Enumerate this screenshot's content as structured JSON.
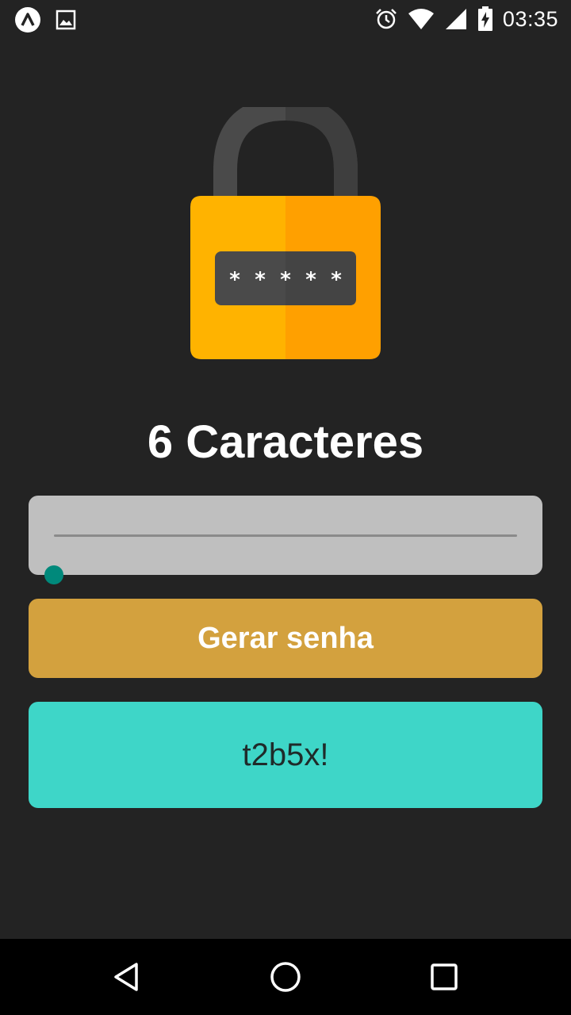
{
  "status_bar": {
    "time": "03:35",
    "icons": [
      "app-notification-icon",
      "image-notification-icon",
      "alarm-icon",
      "wifi-icon",
      "signal-icon",
      "battery-charging-icon"
    ]
  },
  "main": {
    "title": "6 Caracteres",
    "slider": {
      "value": 6,
      "min": 6,
      "max": 20,
      "fraction": 0.0,
      "accent_color": "#00897b"
    },
    "generate_button_label": "Gerar senha",
    "password": "t2b5x!"
  },
  "colors": {
    "background": "#232323",
    "button": "#d3a13e",
    "password_box": "#3ed6c8",
    "lock_body": "#ffb300",
    "lock_shackle": "#4a4a4a"
  },
  "nav_bar": {
    "icons": [
      "back-icon",
      "home-icon",
      "recents-icon"
    ]
  }
}
